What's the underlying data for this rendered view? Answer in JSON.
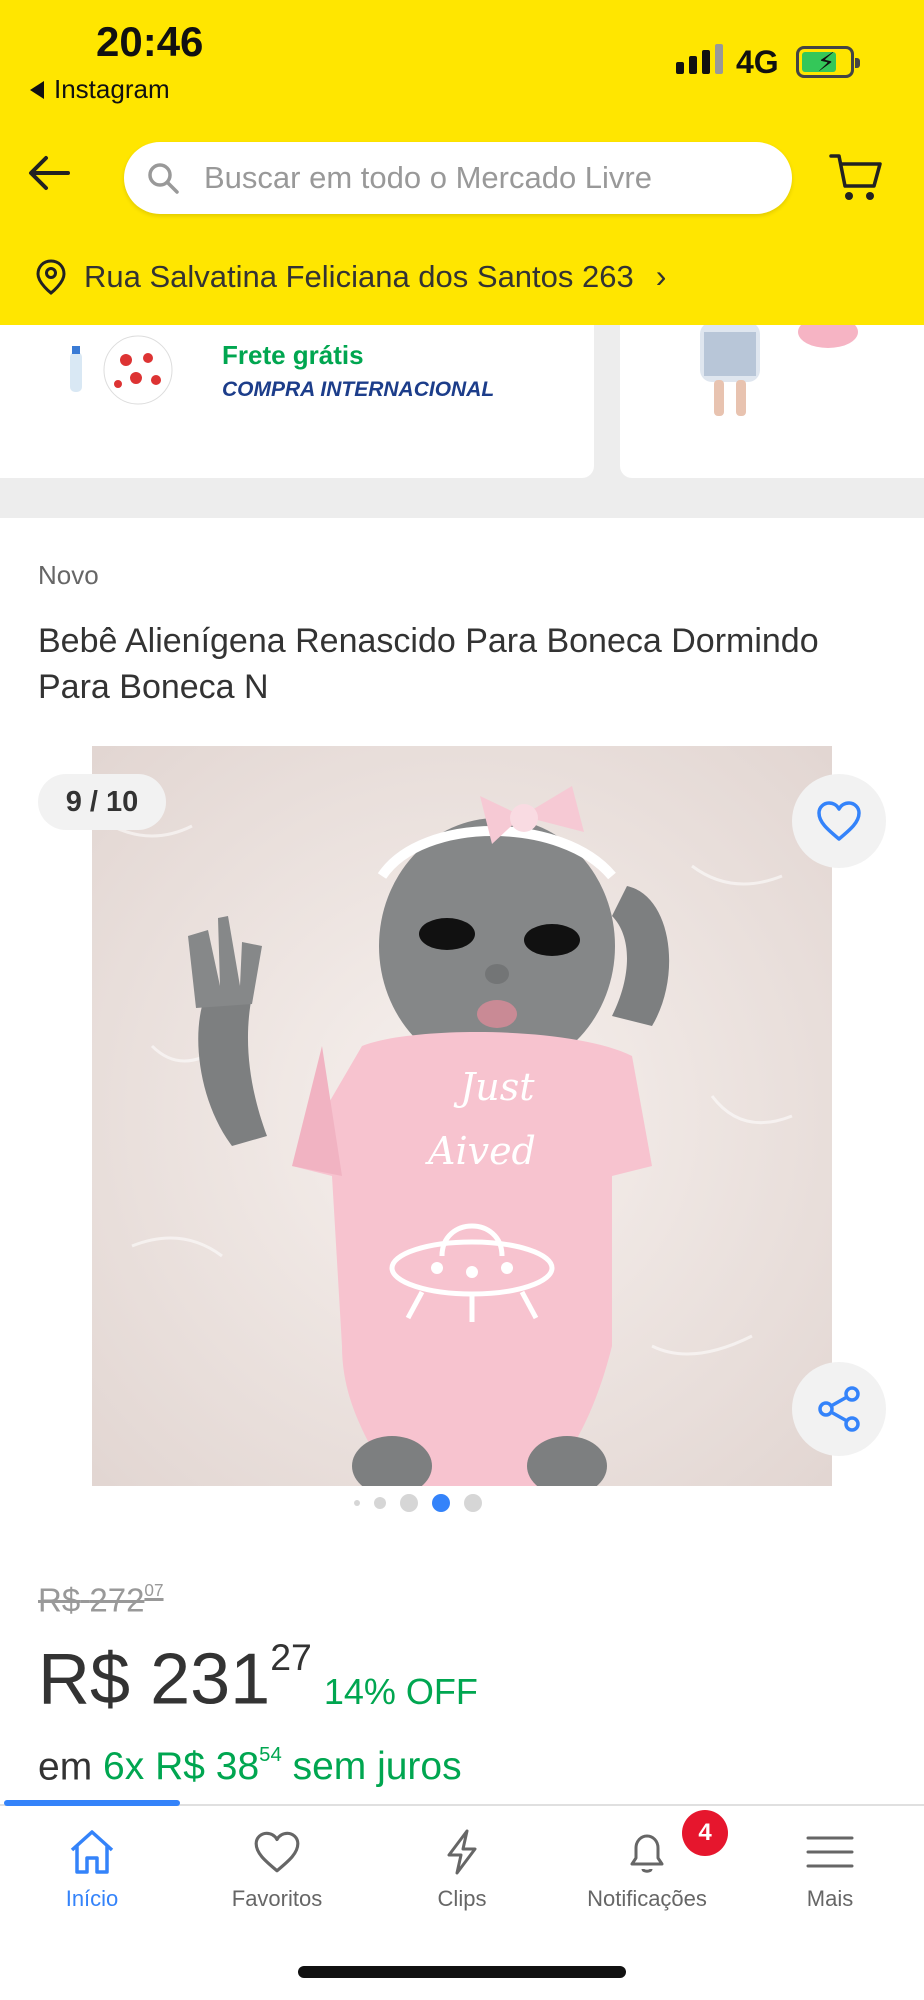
{
  "status_bar": {
    "time": "20:46",
    "back_app": "Instagram",
    "network": "4G"
  },
  "header": {
    "search_placeholder": "Buscar em todo o Mercado Livre",
    "location": "Rua Salvatina Feliciana dos Santos 263"
  },
  "recommendation": {
    "shipping": "Frete grátis",
    "international": "COMPRA INTERNACIONAL"
  },
  "product": {
    "condition": "Novo",
    "title": "Bebê Alienígena Renascido Para Boneca Dormindo Para Boneca N",
    "image_counter": "9 / 10",
    "shirt_text_line1": "Just",
    "shirt_text_line2": "Aived",
    "carousel_active_index": 3,
    "carousel_dot_count": 5
  },
  "price": {
    "currency": "R$",
    "old_int": "272",
    "old_cents": "07",
    "current_int": "231",
    "current_cents": "27",
    "discount": "14% OFF",
    "installments_prefix": "em",
    "installments_count": "6x",
    "installment_int": "38",
    "installment_cents": "54",
    "installments_suffix": "sem juros"
  },
  "bottom_nav": {
    "items": [
      {
        "label": "Início",
        "icon": "home-icon",
        "active": true
      },
      {
        "label": "Favoritos",
        "icon": "heart-icon",
        "active": false
      },
      {
        "label": "Clips",
        "icon": "lightning-icon",
        "active": false
      },
      {
        "label": "Notificações",
        "icon": "bell-icon",
        "active": false
      },
      {
        "label": "Mais",
        "icon": "menu-icon",
        "active": false
      }
    ],
    "notifications_badge": "4"
  },
  "colors": {
    "header_yellow": "#ffe600",
    "accent_blue": "#3483fa",
    "success_green": "#00a650",
    "badge_red": "#e6162d"
  }
}
